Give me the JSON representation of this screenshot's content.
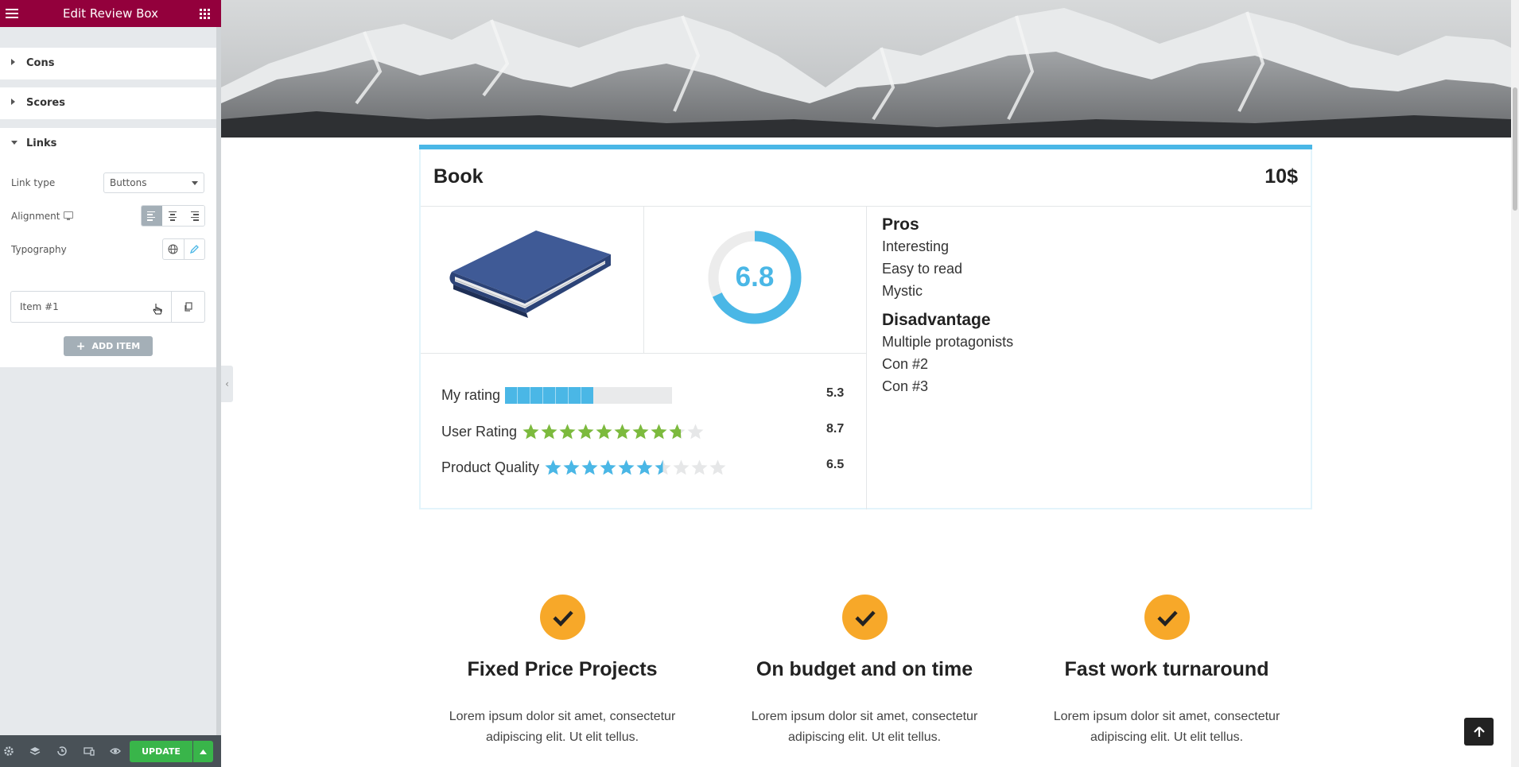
{
  "sidebar": {
    "header_title": "Edit Review Box",
    "sections": {
      "cons": "Cons",
      "scores": "Scores",
      "links": "Links"
    },
    "controls": {
      "link_type_label": "Link type",
      "link_type_value": "Buttons",
      "alignment_label": "Alignment",
      "typography_label": "Typography"
    },
    "repeater_item": "Item #1",
    "add_item": "ADD ITEM",
    "update": "UPDATE"
  },
  "review": {
    "title": "Book",
    "price": "10$",
    "score": "6.8",
    "score_fraction": 0.68,
    "accent_color": "#4ab7e6",
    "ratings": [
      {
        "label": "My rating",
        "value": "5.3",
        "type": "bar",
        "fraction": 0.53
      },
      {
        "label": "User Rating",
        "value": "8.7",
        "type": "stars",
        "fraction": 0.87,
        "color": "#7cba3d"
      },
      {
        "label": "Product Quality",
        "value": "6.5",
        "type": "stars",
        "fraction": 0.65,
        "color": "#4ab7e6"
      }
    ],
    "pros_title": "Pros",
    "pros": [
      "Interesting",
      "Easy to read",
      "Mystic"
    ],
    "cons_title": "Disadvantage",
    "cons": [
      "Multiple protagonists",
      "Con #2",
      "Con #3"
    ]
  },
  "features": [
    {
      "title": "Fixed Price Projects",
      "text": "Lorem ipsum dolor sit amet, consectetur adipiscing elit. Ut elit tellus."
    },
    {
      "title": "On budget and on time",
      "text": "Lorem ipsum dolor sit amet, consectetur adipiscing elit. Ut elit tellus."
    },
    {
      "title": "Fast work turnaround",
      "text": "Lorem ipsum dolor sit amet, consectetur adipiscing elit. Ut elit tellus."
    }
  ],
  "colors": {
    "brand": "#93003c",
    "update_green": "#39b54a",
    "feature_orange": "#f7a829"
  }
}
